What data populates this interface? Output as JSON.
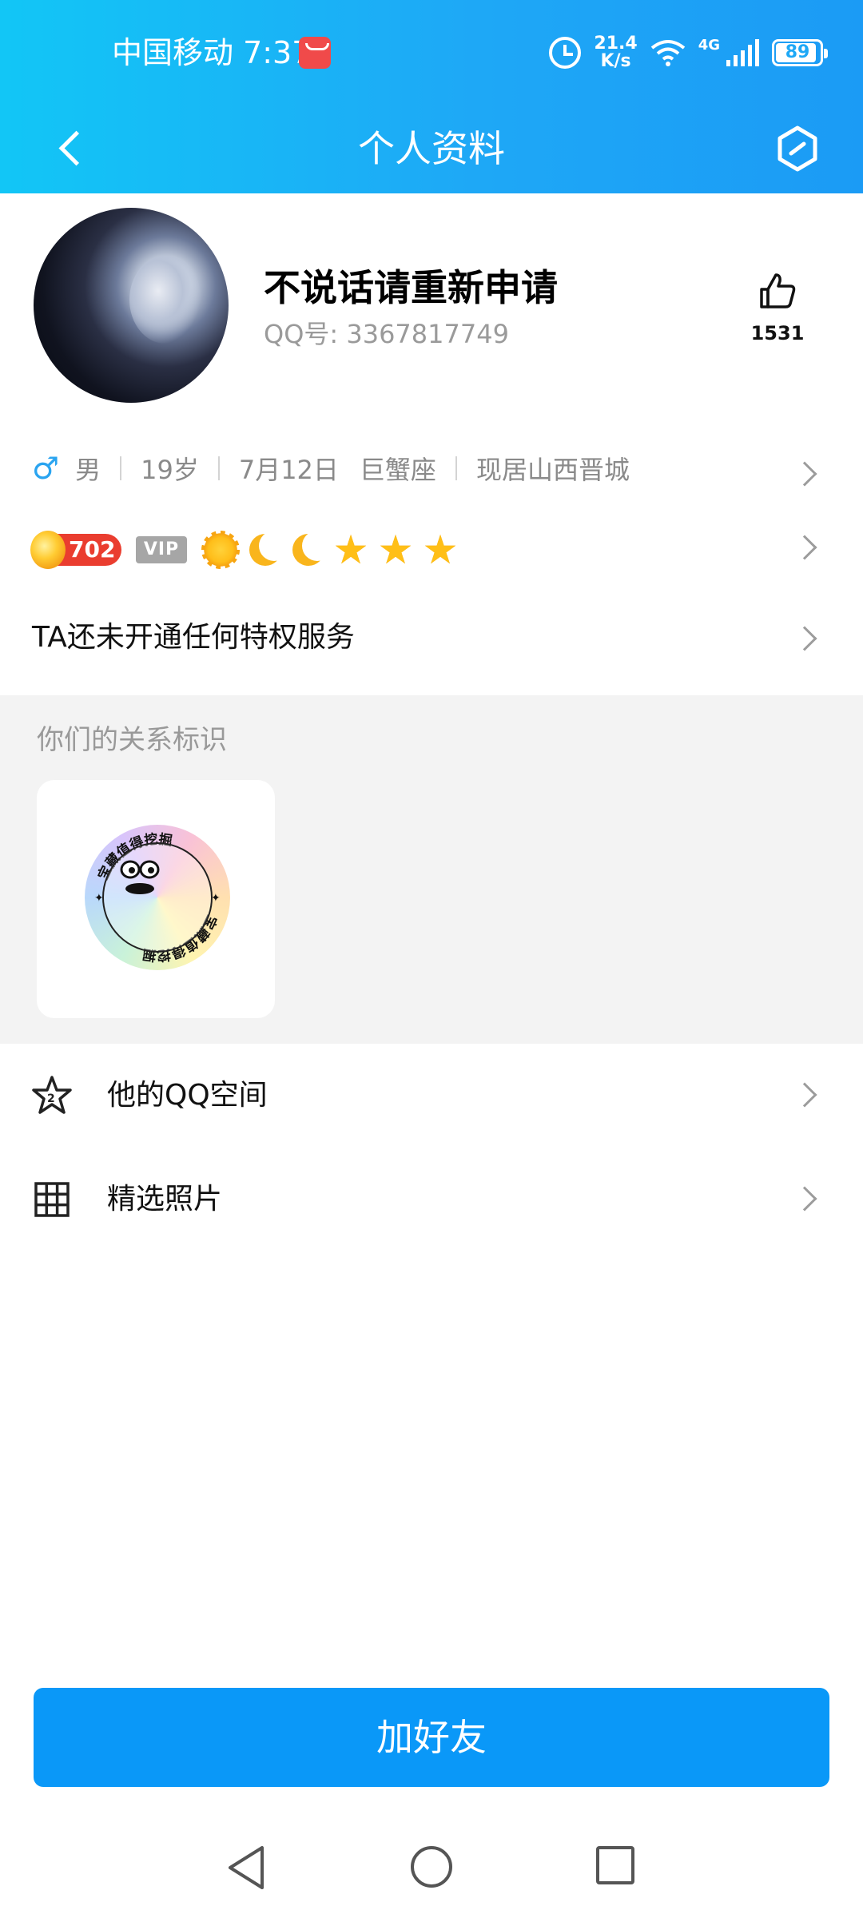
{
  "status_bar": {
    "carrier_time": "中国移动 7:37",
    "net_speed_value": "21.4",
    "net_speed_unit": "K/s",
    "signal_label": "4G",
    "battery": "89"
  },
  "nav": {
    "title": "个人资料"
  },
  "profile": {
    "name": "不说话请重新申请",
    "qq_label": "QQ号:",
    "qq_number": "3367817749",
    "likes": "1531",
    "gender": "男",
    "age": "19岁",
    "birthday": "7月12日",
    "zodiac": "巨蟹座",
    "location": "现居山西晋城"
  },
  "badges": {
    "level": "702",
    "vip": "VIP"
  },
  "privilege": {
    "text": "TA还未开通任何特权服务"
  },
  "relationship": {
    "title": "你们的关系标识",
    "emblem_text": "宝藏值得挖掘"
  },
  "list": [
    {
      "label": "他的QQ空间",
      "icon": "star-icon"
    },
    {
      "label": "精选照片",
      "icon": "grid-icon"
    }
  ],
  "actions": {
    "add_friend": "加好友"
  },
  "colors": {
    "accent": "#0a98f8",
    "header_start": "#12c6f6",
    "header_end": "#1b9bf5",
    "male": "#2aa4f0",
    "level_badge": "#ea3d2f"
  }
}
